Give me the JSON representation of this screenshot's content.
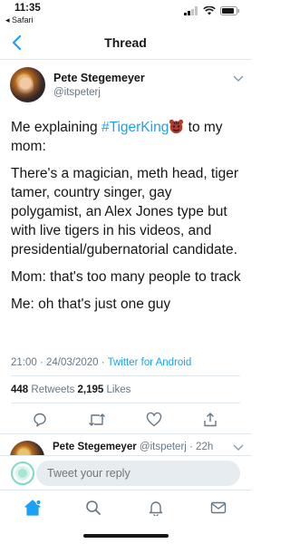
{
  "status_bar": {
    "time": "11:35",
    "back_app": "◂ Safari"
  },
  "nav": {
    "title": "Thread"
  },
  "tweet": {
    "author_name": "Pete Stegemeyer",
    "author_handle": "@itspeterj",
    "line1_pre": "Me explaining ",
    "hashtag": "#TigerKing",
    "line1_post": " to my mom:",
    "paragraph2": "There's a magician, meth head, tiger tamer, country singer,  gay polygamist, an Alex Jones type but with live tigers in his videos,  and presidential/gubernatorial candidate.",
    "paragraph3": "Mom:  that's too many people to track",
    "paragraph4": "Me: oh that's just one guy",
    "timestamp": "21:00 · 24/03/2020 · ",
    "source": "Twitter for Android",
    "retweet_count": "448",
    "retweet_label": " Retweets ",
    "like_count": "2,195",
    "like_label": " Likes"
  },
  "reply": {
    "author_name": "Pete Stegemeyer",
    "author_handle_time": " @itspeterj · 22h"
  },
  "compose": {
    "placeholder": "Tweet your reply"
  },
  "colors": {
    "accent": "#1da1f2",
    "muted": "#657786",
    "text": "#14171a",
    "divider": "#e1e8ed"
  },
  "icons": {
    "tabs": [
      "home-icon",
      "search-icon",
      "notifications-icon",
      "messages-icon"
    ],
    "actions": [
      "reply-icon",
      "retweet-icon",
      "like-icon",
      "share-icon"
    ]
  }
}
